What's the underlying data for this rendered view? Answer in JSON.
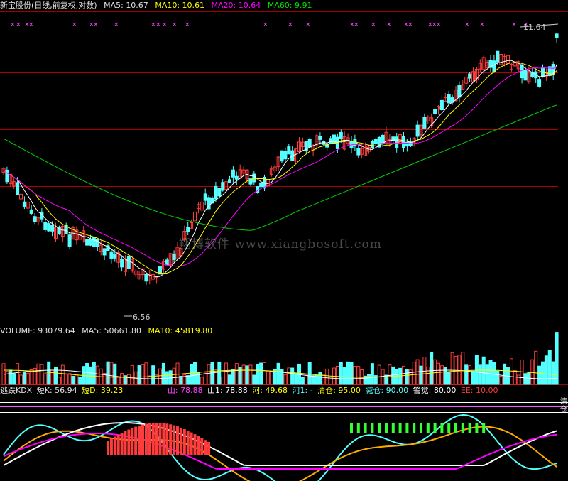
{
  "price_header": {
    "title": "新宝股份(日线,前复权,对数)",
    "ma5_label": "MA5:",
    "ma5_value": "10.67",
    "ma10_label": "MA10:",
    "ma10_value": "10.61",
    "ma20_label": "MA20:",
    "ma20_value": "10.64",
    "ma60_label": "MA60:",
    "ma60_value": "9.91"
  },
  "volume_header": {
    "title": "VOLUME:",
    "value": "93079.64",
    "ma5_label": "MA5:",
    "ma5_value": "50661.80",
    "ma10_label": "MA10:",
    "ma10_value": "45819.80"
  },
  "kdx_header": {
    "title": "逃跌KDX",
    "short_k_label": "短K:",
    "short_k_value": "56.94",
    "short_d_label": "短D:",
    "short_d_value": "39.23",
    "shan_label": "山:",
    "shan_value": "78.88",
    "shan1_label": "山1:",
    "shan1_value": "78.88",
    "he_label": "河:",
    "he_value": "49.68",
    "he1_label": "河1:",
    "he1_value": "-",
    "qingcang_label": "清仓:",
    "qingcang_value": "95.00",
    "jiancang_label": "减仓:",
    "jiancang_value": "90.00",
    "jingjue_label": "警觉:",
    "jingjue_value": "80.00",
    "ee_label": "EE:",
    "ee_value": "10.00"
  },
  "markers": {
    "high_label": "11.64",
    "low_label": "6.56"
  },
  "signal_symbol": "×",
  "watermark": "翔博软件 www.xiangbosoft.com",
  "side_label": "清仓",
  "colors": {
    "up": "#ff3c3c",
    "down": "#54ffff",
    "ma5": "#ffffff",
    "ma10": "#ffff00",
    "ma20": "#ff00ff",
    "ma60": "#00d000",
    "grid": "#b00000",
    "signal": "#ff50ff"
  }
}
